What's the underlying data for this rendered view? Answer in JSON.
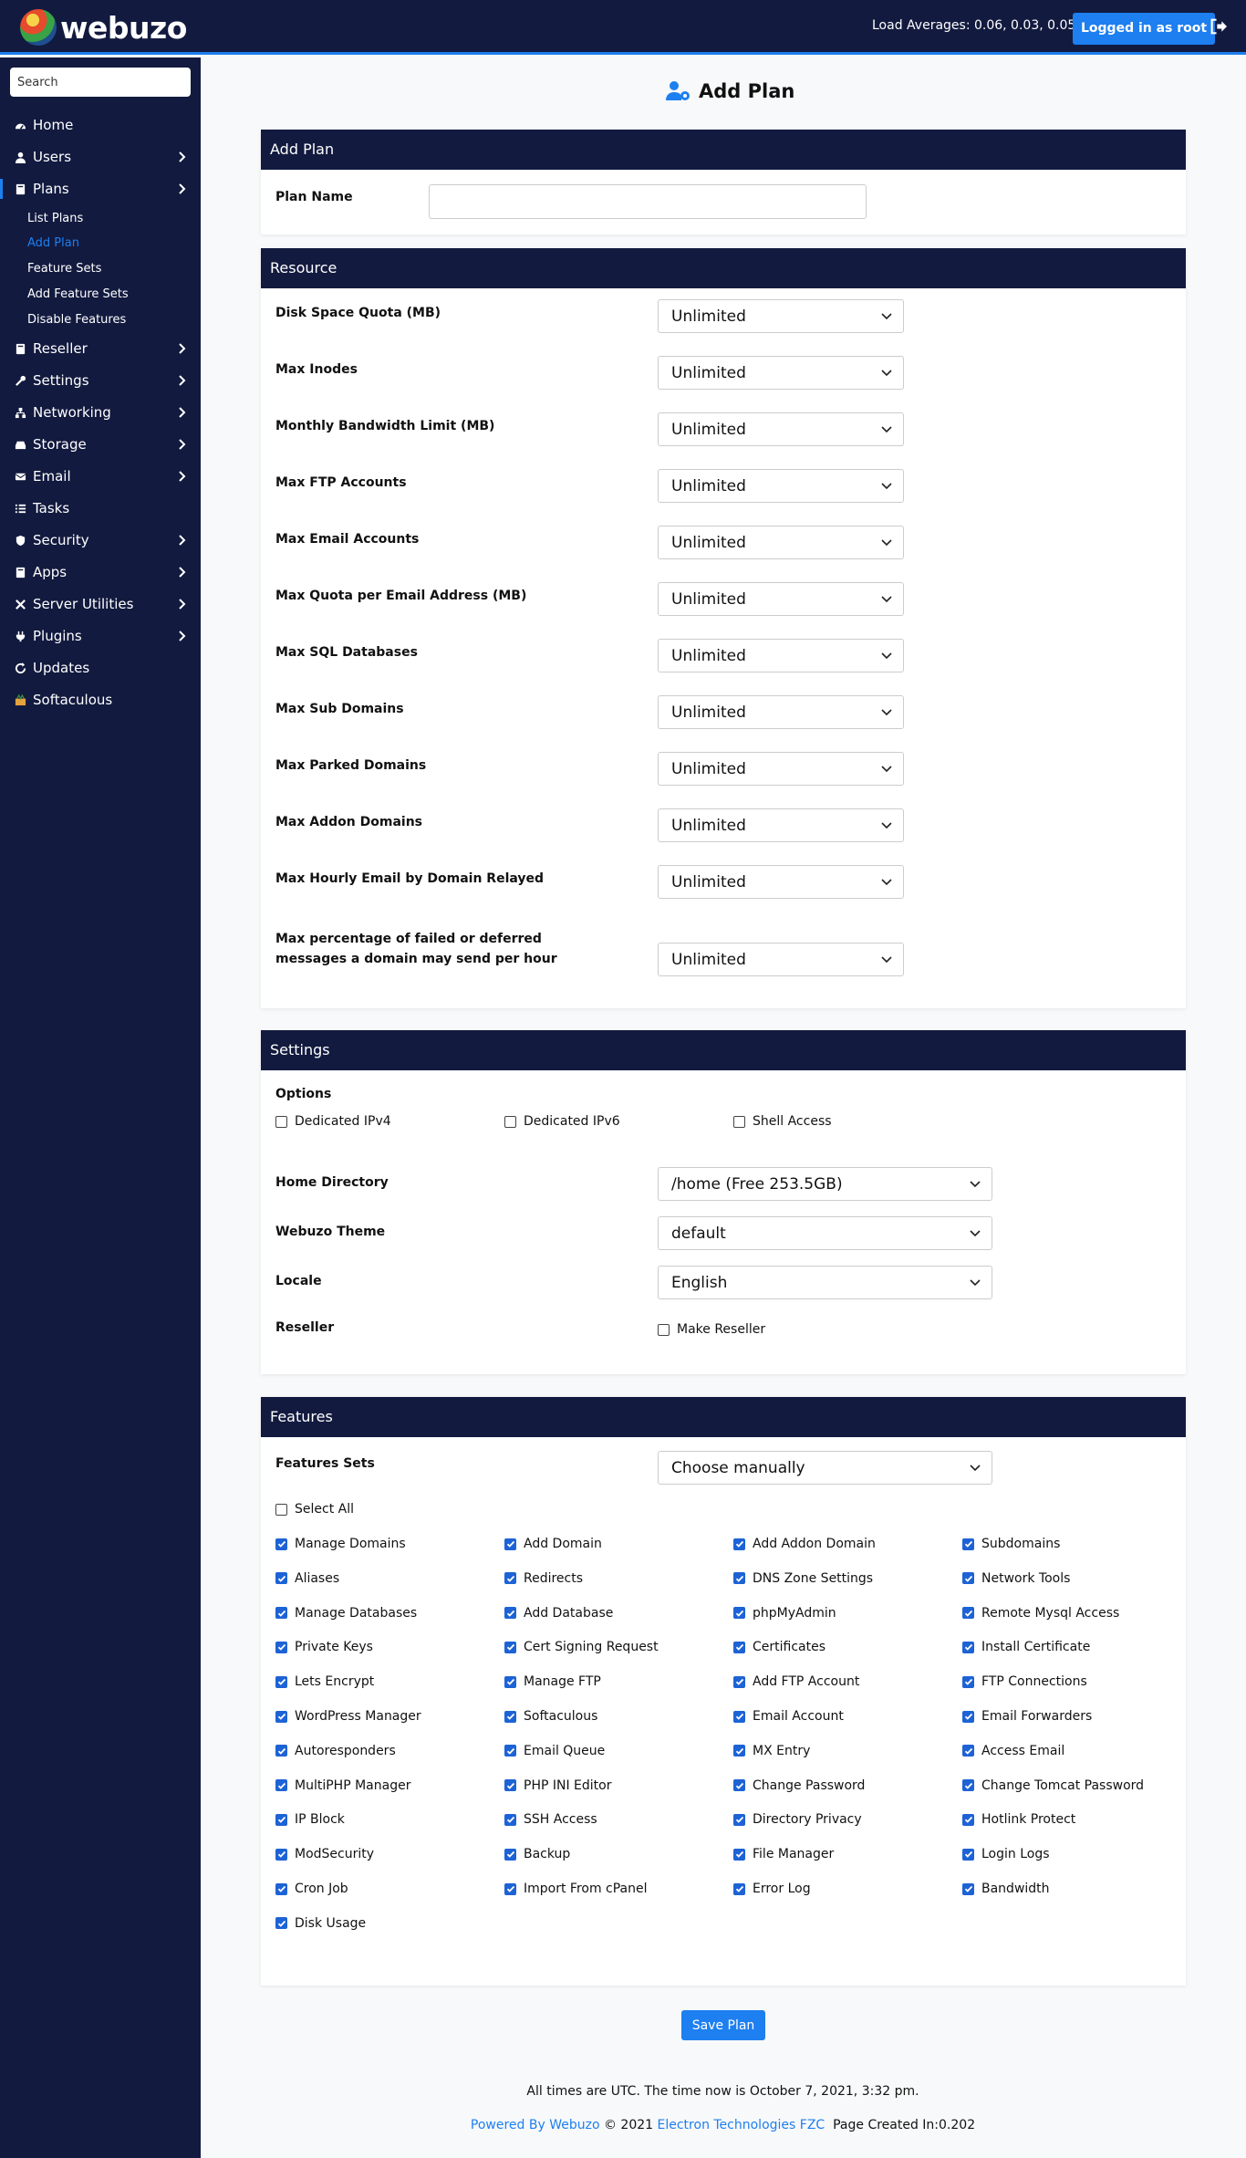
{
  "header": {
    "logo_text": "webuzo",
    "load_averages": "Load Averages: 0.06, 0.03, 0.05",
    "logged_in": "Logged in as root"
  },
  "sidebar": {
    "search_placeholder": "Search",
    "items": [
      {
        "label": "Home",
        "icon": "gauge-icon"
      },
      {
        "label": "Users",
        "icon": "user-icon"
      },
      {
        "label": "Plans",
        "icon": "book-icon"
      },
      {
        "label": "Reseller",
        "icon": "book-icon"
      },
      {
        "label": "Settings",
        "icon": "wrench-icon"
      },
      {
        "label": "Networking",
        "icon": "network-icon"
      },
      {
        "label": "Storage",
        "icon": "hdd-icon"
      },
      {
        "label": "Email",
        "icon": "envelope-icon"
      },
      {
        "label": "Tasks",
        "icon": "list-icon"
      },
      {
        "label": "Security",
        "icon": "shield-icon"
      },
      {
        "label": "Apps",
        "icon": "book-icon"
      },
      {
        "label": "Server Utilities",
        "icon": "tools-icon"
      },
      {
        "label": "Plugins",
        "icon": "plug-icon"
      },
      {
        "label": "Updates",
        "icon": "refresh-icon"
      },
      {
        "label": "Softaculous",
        "icon": "softaculous-icon"
      }
    ],
    "plans_sub": [
      "List Plans",
      "Add Plan",
      "Feature Sets",
      "Add Feature Sets",
      "Disable Features"
    ]
  },
  "page": {
    "title": "Add Plan"
  },
  "add_plan": {
    "heading": "Add Plan",
    "plan_name_label": "Plan Name",
    "plan_name_value": ""
  },
  "resource": {
    "heading": "Resource",
    "rows": [
      {
        "label": "Disk Space Quota (MB)",
        "value": "Unlimited"
      },
      {
        "label": "Max Inodes",
        "value": "Unlimited"
      },
      {
        "label": "Monthly Bandwidth Limit (MB)",
        "value": "Unlimited"
      },
      {
        "label": "Max FTP Accounts",
        "value": "Unlimited"
      },
      {
        "label": "Max Email Accounts",
        "value": "Unlimited"
      },
      {
        "label": "Max Quota per Email Address (MB)",
        "value": "Unlimited"
      },
      {
        "label": "Max SQL Databases",
        "value": "Unlimited"
      },
      {
        "label": "Max Sub Domains",
        "value": "Unlimited"
      },
      {
        "label": "Max Parked Domains",
        "value": "Unlimited"
      },
      {
        "label": "Max Addon Domains",
        "value": "Unlimited"
      },
      {
        "label": "Max Hourly Email by Domain Relayed",
        "value": "Unlimited"
      },
      {
        "label": "Max percentage of failed or deferred messages a domain may send per hour",
        "value": "Unlimited"
      }
    ]
  },
  "settings": {
    "heading": "Settings",
    "options_label": "Options",
    "options": [
      {
        "label": "Dedicated IPv4",
        "checked": false
      },
      {
        "label": "Dedicated IPv6",
        "checked": false
      },
      {
        "label": "Shell Access",
        "checked": false
      }
    ],
    "home_dir_label": "Home Directory",
    "home_dir_value": "/home (Free 253.5GB)",
    "theme_label": "Webuzo Theme",
    "theme_value": "default",
    "locale_label": "Locale",
    "locale_value": "English",
    "reseller_label": "Reseller",
    "make_reseller_label": "Make Reseller"
  },
  "features": {
    "heading": "Features",
    "sets_label": "Features Sets",
    "sets_value": "Choose manually",
    "select_all": "Select All",
    "items": [
      "Manage Domains",
      "Add Domain",
      "Add Addon Domain",
      "Subdomains",
      "Aliases",
      "Redirects",
      "DNS Zone Settings",
      "Network Tools",
      "Manage Databases",
      "Add Database",
      "phpMyAdmin",
      "Remote Mysql Access",
      "Private Keys",
      "Cert Signing Request",
      "Certificates",
      "Install Certificate",
      "Lets Encrypt",
      "Manage FTP",
      "Add FTP Account",
      "FTP Connections",
      "WordPress Manager",
      "Softaculous",
      "Email Account",
      "Email Forwarders",
      "Autoresponders",
      "Email Queue",
      "MX Entry",
      "Access Email",
      "MultiPHP Manager",
      "PHP INI Editor",
      "Change Password",
      "Change Tomcat Password",
      "IP Block",
      "SSH Access",
      "Directory Privacy",
      "Hotlink Protect",
      "ModSecurity",
      "Backup",
      "File Manager",
      "Login Logs",
      "Cron Job",
      "Import From cPanel",
      "Error Log",
      "Bandwidth",
      "Disk Usage"
    ]
  },
  "save_label": "Save Plan",
  "footer": {
    "time_text": "All times are UTC. The time now is October 7, 2021, 3:32 pm.",
    "powered_by": "Powered By Webuzo",
    "copyright": "© 2021",
    "company": "Electron Technologies FZC",
    "page_created": "Page Created In:0.202"
  },
  "colors": {
    "navy": "#121a3f",
    "accent": "#1d7ff0",
    "checkbox": "#1d63d6"
  }
}
